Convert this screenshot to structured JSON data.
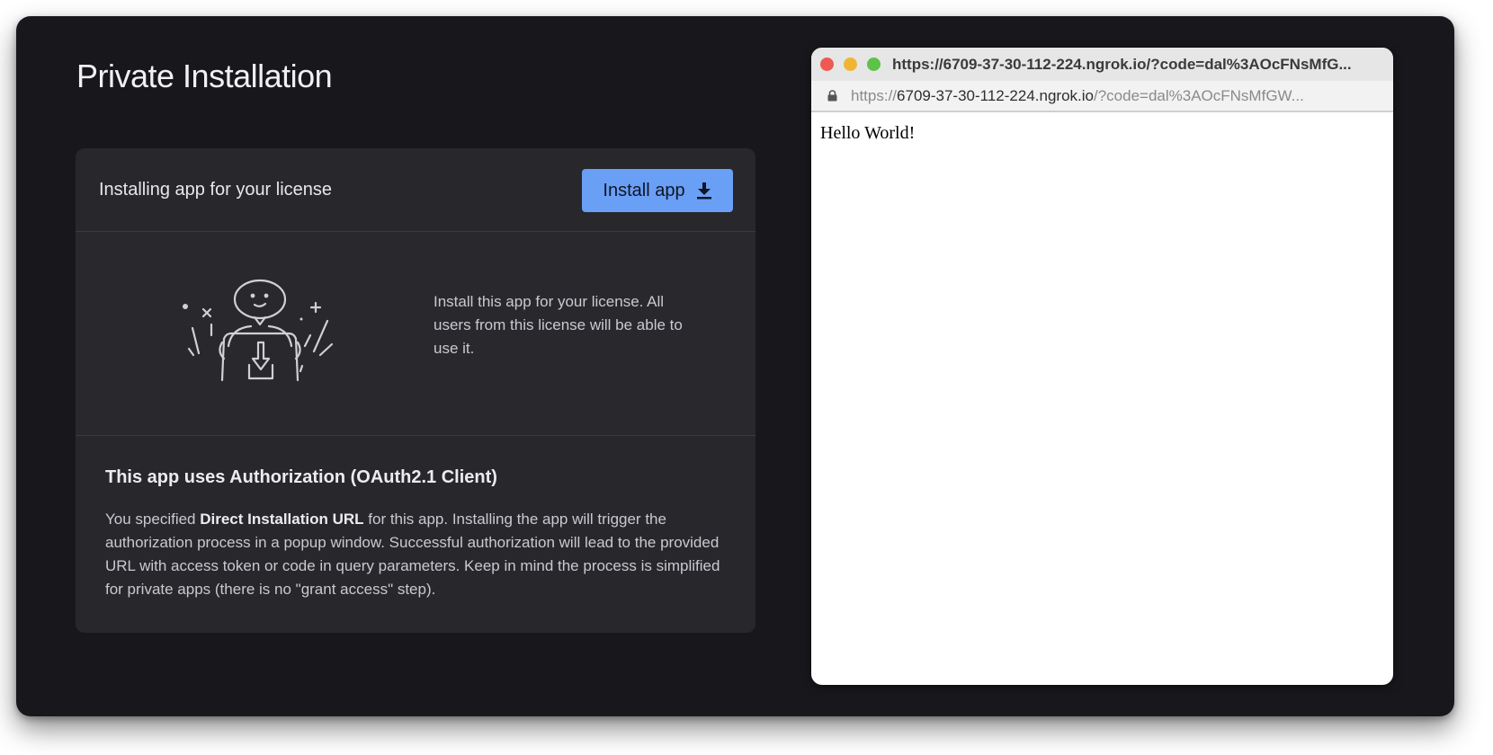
{
  "page": {
    "title": "Private Installation"
  },
  "install_card": {
    "header_title": "Installing app for your license",
    "install_button_label": "Install app",
    "install_button_icon": "download-icon",
    "illustration_icon": "person-installing-illustration",
    "description": "Install this app for your license. All users from this license will be able to use it.",
    "oauth": {
      "heading": "This app uses Authorization (OAuth2.1 Client)",
      "text_before": "You specified ",
      "text_bold": "Direct Installation URL",
      "text_after": " for this app. Installing the app will trigger the authorization process in a popup window. Successful authorization will lead to the provided URL with access token or code in query parameters. Keep in mind the process is simplified for private apps (there is no \"grant access\" step)."
    }
  },
  "popup": {
    "title": "https://6709-37-30-112-224.ngrok.io/?code=dal%3AOcFNsMfG...",
    "address_scheme": "https://",
    "address_host": "6709-37-30-112-224.ngrok.io",
    "address_rest": "/?code=dal%3AOcFNsMfGW...",
    "lock_icon": "lock-icon",
    "content": "Hello World!"
  },
  "colors": {
    "app_background": "#18181c",
    "card_background": "#27272c",
    "accent": "#6a9ff6",
    "traffic_close": "#ee5a52",
    "traffic_minimize": "#f0b534",
    "traffic_zoom": "#5ec148"
  }
}
